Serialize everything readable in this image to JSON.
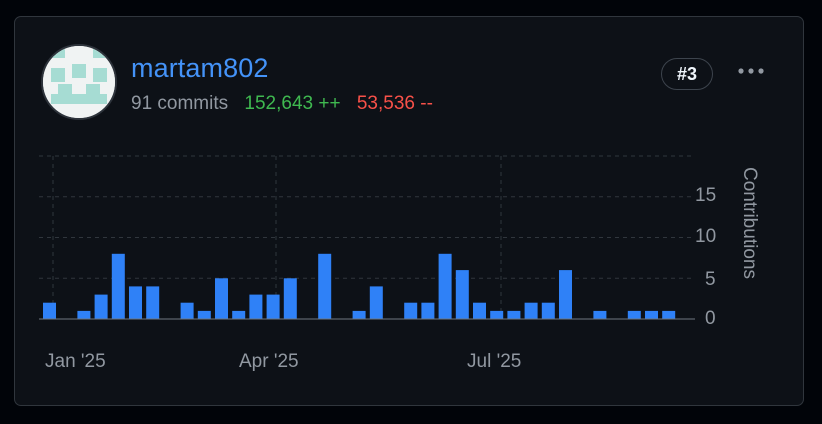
{
  "contributor": {
    "username": "martam802",
    "commits": "91 commits",
    "additions": "152,643 ++",
    "deletions": "53,536 --",
    "rank": "#3",
    "avatar_icon": "identicon",
    "more_icon": "kebab-horizontal-icon"
  },
  "colors": {
    "link": "#4493f8",
    "additions": "#3fb950",
    "deletions": "#f85149",
    "bar": "#2f81f7",
    "identicon": "#a6dcd3"
  },
  "chart_data": {
    "type": "bar",
    "ylabel": "Contributions",
    "y_ticks": [
      "0",
      "5",
      "10",
      "15"
    ],
    "ylim": [
      0,
      20
    ],
    "x_tick_labels": [
      "Jan '25",
      "Apr '25",
      "Jul '25"
    ],
    "grid": true,
    "bar_dates": [
      "2024-12-29",
      "2025-01-05",
      "2025-01-12",
      "2025-01-19",
      "2025-01-26",
      "2025-02-02",
      "2025-02-09",
      "2025-02-16",
      "2025-02-23",
      "2025-03-02",
      "2025-03-09",
      "2025-03-16",
      "2025-03-23",
      "2025-03-30",
      "2025-04-06",
      "2025-04-13",
      "2025-04-20",
      "2025-04-27",
      "2025-05-04",
      "2025-05-11",
      "2025-05-18",
      "2025-05-25",
      "2025-06-01",
      "2025-06-08",
      "2025-06-15",
      "2025-06-22",
      "2025-06-29",
      "2025-07-06",
      "2025-07-13",
      "2025-07-20",
      "2025-07-27",
      "2025-08-03",
      "2025-08-10",
      "2025-08-17",
      "2025-08-24",
      "2025-08-31",
      "2025-09-07",
      "2025-09-14"
    ],
    "values": [
      2,
      0,
      1,
      3,
      8,
      4,
      4,
      0,
      2,
      1,
      5,
      1,
      3,
      3,
      5,
      0,
      8,
      0,
      1,
      4,
      0,
      2,
      2,
      8,
      6,
      2,
      1,
      1,
      2,
      2,
      6,
      0,
      1,
      0,
      1,
      1,
      1,
      0
    ]
  }
}
